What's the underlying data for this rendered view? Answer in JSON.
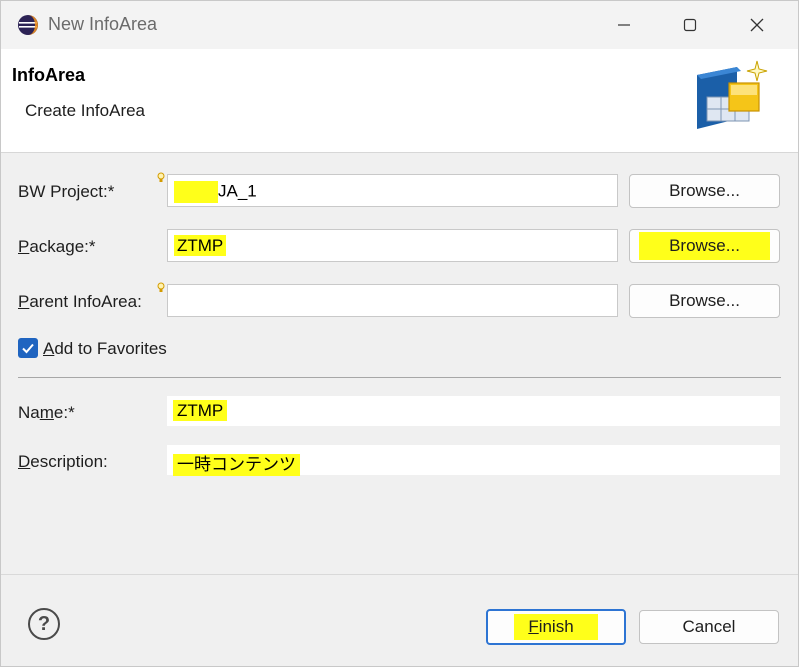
{
  "window": {
    "title": "New InfoArea"
  },
  "banner": {
    "title": "InfoArea",
    "subtitle": "Create InfoArea"
  },
  "form": {
    "bw_project": {
      "label": "BW Project:*",
      "value": "JA_1",
      "browse_label": "Browse..."
    },
    "package": {
      "label_pre": "",
      "label_mnemonic": "P",
      "label_post": "ackage:*",
      "value": "ZTMP",
      "browse_label": "Browse..."
    },
    "parent_infoarea": {
      "label_mnemonic": "P",
      "label_post": "arent InfoArea:",
      "value": "",
      "browse_label": "Browse..."
    },
    "add_to_favorites": {
      "label_mnemonic": "A",
      "label_post": "dd to Favorites",
      "checked": true
    },
    "name": {
      "label_pre": "Na",
      "label_mnemonic": "m",
      "label_post": "e:*",
      "value": "ZTMP"
    },
    "description": {
      "label_mnemonic": "D",
      "label_post": "escription:",
      "value": "一時コンテンツ"
    }
  },
  "footer": {
    "help_symbol": "?",
    "finish_mnemonic": "F",
    "finish_post": "inish",
    "cancel_label": "Cancel"
  },
  "colors": {
    "highlight": "#ffff1a",
    "accent": "#1f64c0"
  }
}
